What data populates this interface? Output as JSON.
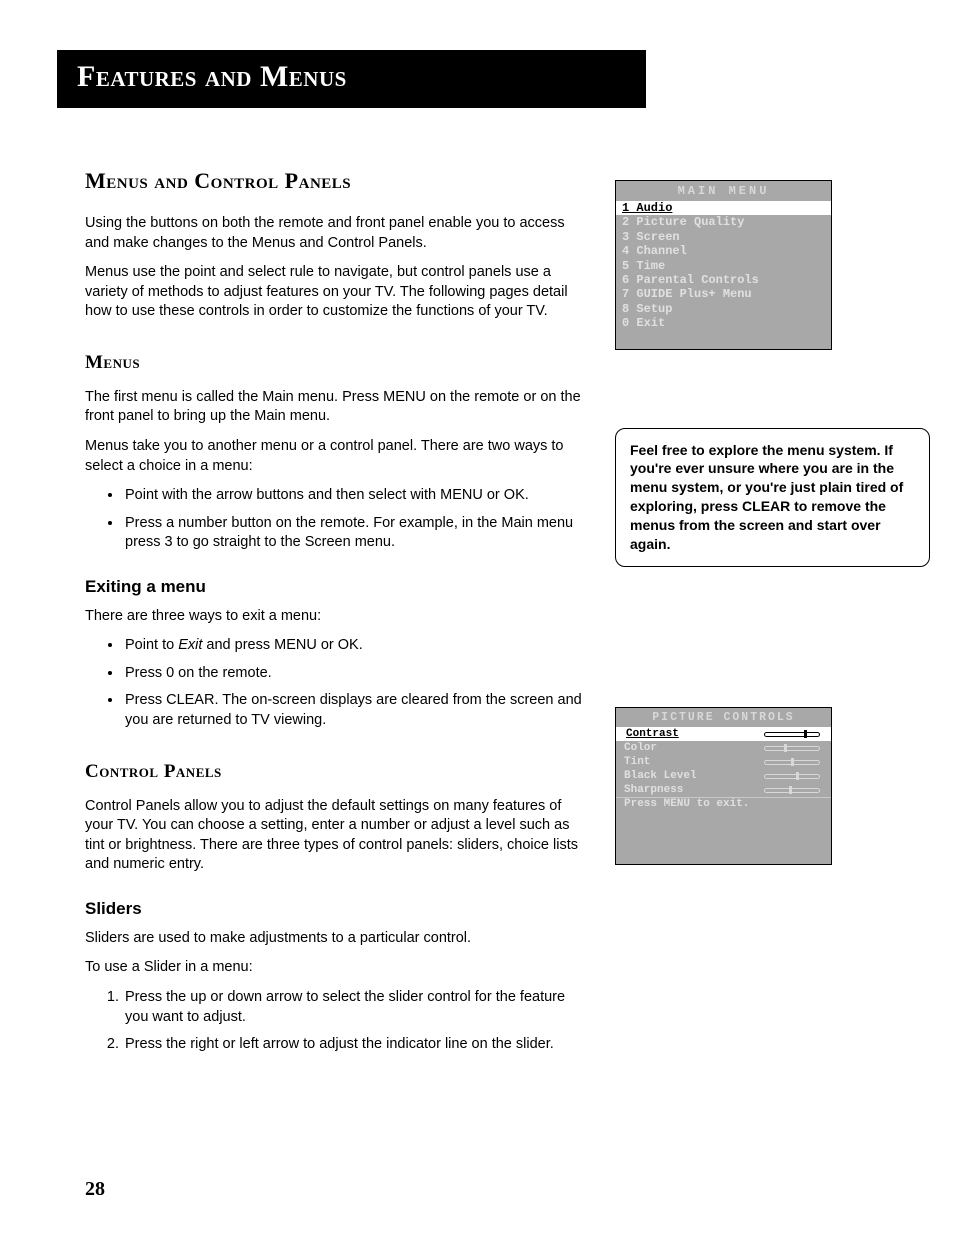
{
  "chapterTitle": "Features and Menus",
  "h2": "Menus and Control Panels",
  "intro1": "Using the buttons on both the remote and front panel enable you to access and make changes to the Menus and Control Panels.",
  "intro2": "Menus use the point and select rule to navigate, but control panels use a variety of methods to adjust features on your TV. The following pages detail how to use these controls in order to customize the functions of your TV.",
  "menus": {
    "heading": "Menus",
    "p1": "The first menu is called the Main menu. Press MENU on the remote or on the front panel to bring up the Main menu.",
    "p2": "Menus take you to another menu or a control panel. There are two ways to select a choice in a menu:",
    "bullets": [
      "Point with the arrow buttons and then select with MENU or OK.",
      "Press a number button on the remote. For example, in the Main menu press 3 to go straight to the Screen menu."
    ]
  },
  "exiting": {
    "heading": "Exiting a menu",
    "p": "There are three ways to exit a menu:",
    "bullets": [
      {
        "pre": "Point to ",
        "italic": "Exit",
        "post": " and press MENU or OK."
      },
      {
        "text": "Press 0 on the remote."
      },
      {
        "text": "Press CLEAR. The on-screen displays are cleared from the screen and you are returned to TV viewing."
      }
    ]
  },
  "controlPanels": {
    "heading": "Control Panels",
    "p": "Control Panels allow you to adjust the default settings on many features of your TV. You can choose a setting, enter a number or adjust a level such as tint or brightness. There are three types of control panels: sliders, choice lists and numeric entry."
  },
  "sliders": {
    "heading": "Sliders",
    "p1": "Sliders are used to make adjustments to a particular control.",
    "p2": "To use a Slider in a menu:",
    "steps": [
      "Press the up or down arrow to select the slider control for the feature you want to adjust.",
      "Press the right or left arrow to adjust the indicator line on the slider."
    ]
  },
  "mainMenu": {
    "title": "MAIN MENU",
    "items": [
      {
        "n": "1",
        "label": "Audio",
        "selected": true
      },
      {
        "n": "2",
        "label": "Picture Quality",
        "selected": false
      },
      {
        "n": "3",
        "label": "Screen",
        "selected": false
      },
      {
        "n": "4",
        "label": "Channel",
        "selected": false
      },
      {
        "n": "5",
        "label": "Time",
        "selected": false
      },
      {
        "n": "6",
        "label": "Parental Controls",
        "selected": false
      },
      {
        "n": "7",
        "label": "GUIDE Plus+ Menu",
        "selected": false
      },
      {
        "n": "8",
        "label": "Setup",
        "selected": false
      },
      {
        "n": "0",
        "label": "Exit",
        "selected": false
      }
    ]
  },
  "tip": "Feel free to explore the menu system. If you're ever unsure where you are in the menu system, or you're just plain tired of exploring, press CLEAR to remove the menus from the screen and start over again.",
  "pictureControls": {
    "title": "PICTURE CONTROLS",
    "rows": [
      {
        "label": "Contrast",
        "pos": 72,
        "selected": true
      },
      {
        "label": "Color",
        "pos": 35,
        "selected": false
      },
      {
        "label": "Tint",
        "pos": 48,
        "selected": false
      },
      {
        "label": "Black Level",
        "pos": 57,
        "selected": false
      },
      {
        "label": "Sharpness",
        "pos": 45,
        "selected": false
      }
    ],
    "footer": "Press MENU to exit."
  },
  "pageNumber": "28"
}
